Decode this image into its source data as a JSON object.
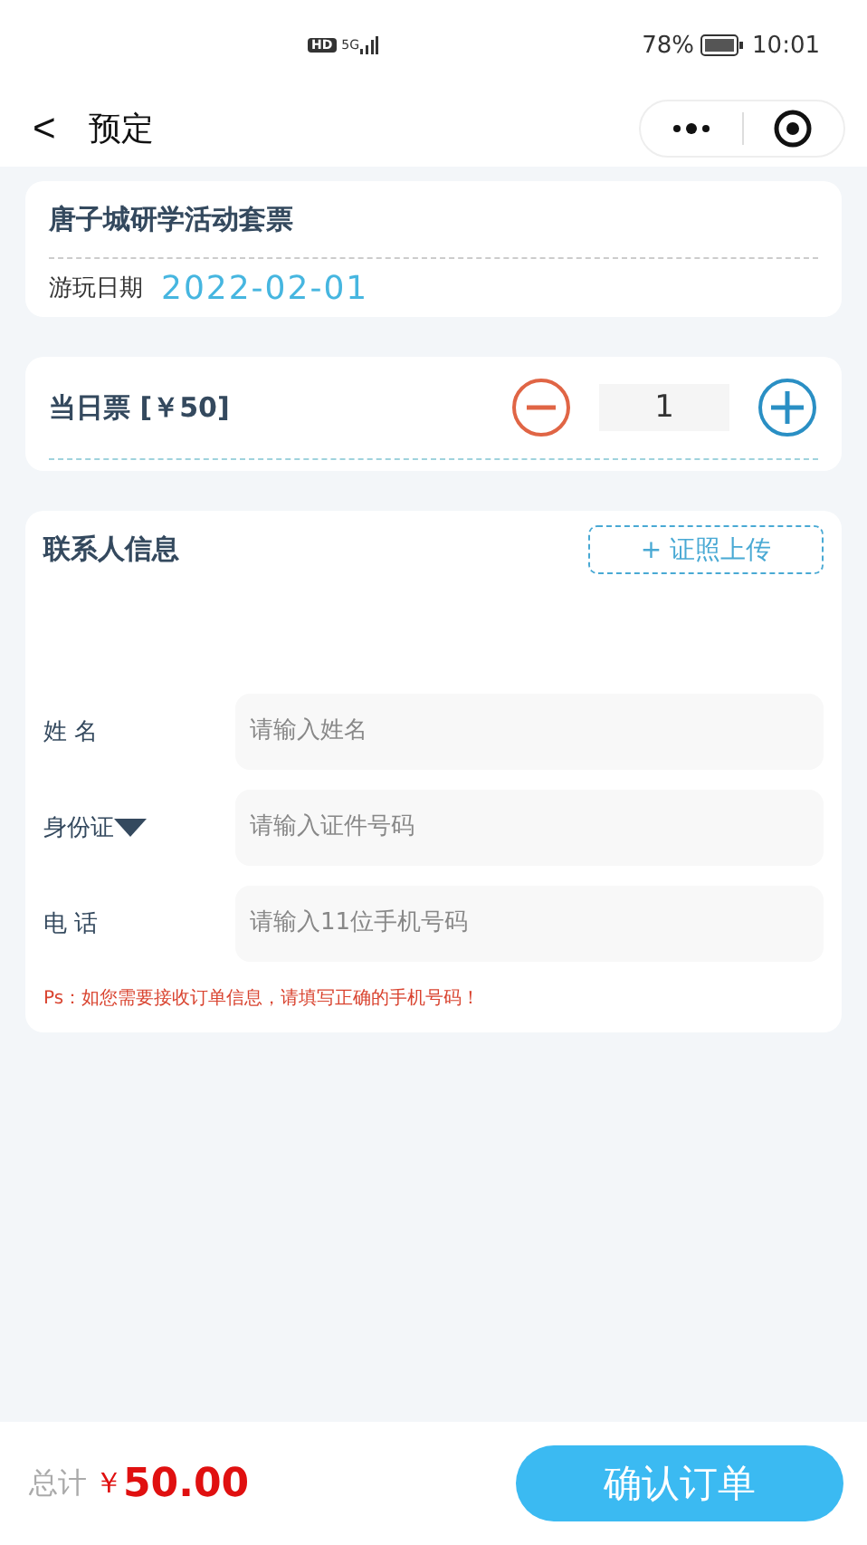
{
  "status_bar": {
    "hd": "HD",
    "network": "5G",
    "battery": "78%",
    "time": "10:01"
  },
  "nav": {
    "back": "<",
    "title": "预定"
  },
  "ticket": {
    "name": "唐子城研学活动套票",
    "date_label": "游玩日期",
    "date": "2022-02-01"
  },
  "quantity": {
    "label": "当日票 [￥50]",
    "value": "1"
  },
  "contact": {
    "title": "联系人信息",
    "upload_button": "+ 证照上传",
    "fields": [
      {
        "kind": "text",
        "label": "姓 名",
        "placeholder": "请输入姓名"
      },
      {
        "kind": "select",
        "label": "身份证",
        "placeholder": "请输入证件号码"
      },
      {
        "kind": "text",
        "label": "电 话",
        "placeholder": "请输入11位手机号码"
      }
    ],
    "note": "Ps：如您需要接收订单信息，请填写正确的手机号码！"
  },
  "footer": {
    "total_label": "总计",
    "currency": "￥",
    "total": "50.00",
    "confirm_button": "确认订单"
  }
}
